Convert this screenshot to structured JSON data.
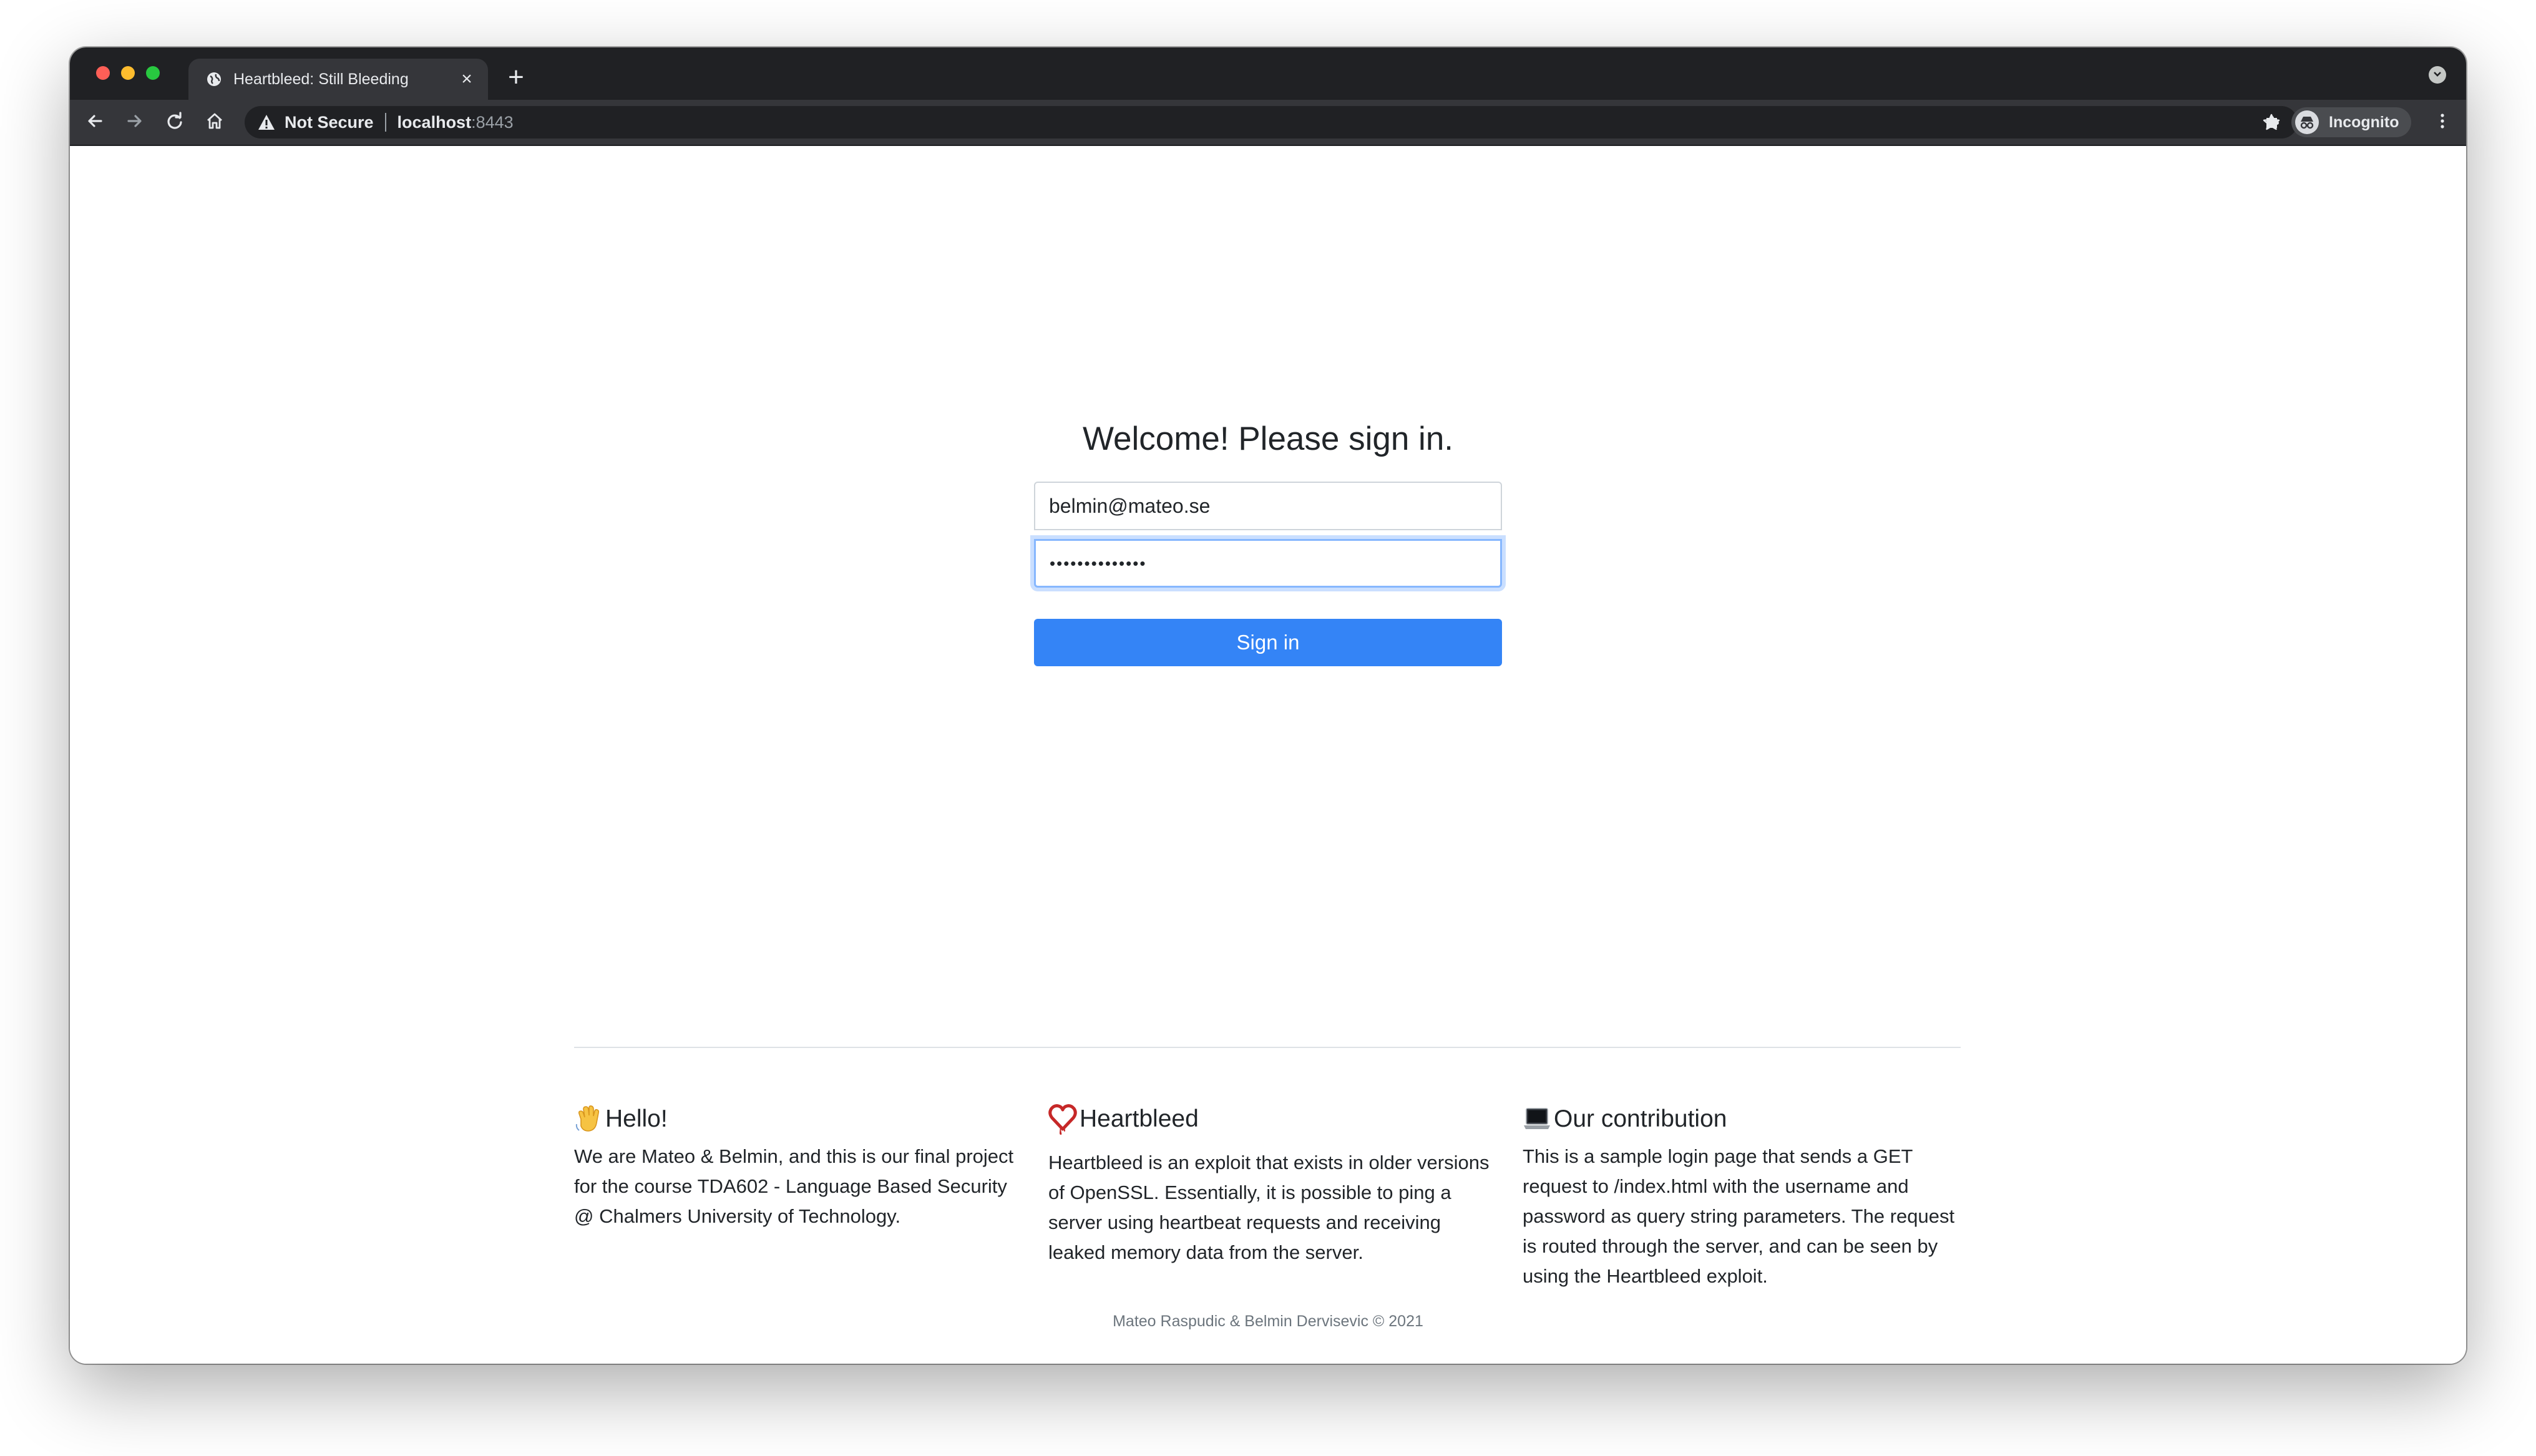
{
  "browser": {
    "tab": {
      "title": "Heartbleed: Still Bleeding",
      "close_label": "×",
      "favicon": "globe-icon"
    },
    "new_tab_label": "+",
    "address_bar": {
      "security_label": "Not Secure",
      "host": "localhost",
      "port": ":8443"
    },
    "profile_label": "Incognito",
    "icons": [
      "back-icon",
      "forward-icon",
      "reload-icon",
      "home-icon",
      "warning-icon",
      "star-icon",
      "extensions-icon",
      "incognito-icon",
      "menu-icon",
      "tab-search-icon"
    ]
  },
  "signin": {
    "heading": "Welcome! Please sign in.",
    "email_value": "belmin@mateo.se",
    "password_value": "••••••••••••••",
    "button_label": "Sign in"
  },
  "info": [
    {
      "emoji": "waving-hand-icon",
      "title": "Hello!",
      "body": "We are Mateo & Belmin, and this is our final project for the course TDA602 - Language Based Security @ Chalmers University of Technology."
    },
    {
      "emoji": "heartbleed-heart-icon",
      "title": "Heartbleed",
      "body": "Heartbleed is an exploit that exists in older versions of OpenSSL. Essentially, it is possible to ping a server using heartbeat requests and receiving leaked memory data from the server."
    },
    {
      "emoji": "laptop-icon",
      "title": "Our contribution",
      "body": "This is a sample login page that sends a GET request to /index.html with the username and password as query string parameters. The request is routed through the server, and can be seen by using the Heartbleed exploit."
    }
  ],
  "footer": {
    "credit": "Mateo Raspudic & Belmin Dervisevic © 2021"
  },
  "colors": {
    "primary_button": "#3484f6",
    "focus_ring": "#86b7fe",
    "browser_frame": "#202124",
    "toolbar": "#35363a",
    "heart_red": "#c62828"
  }
}
